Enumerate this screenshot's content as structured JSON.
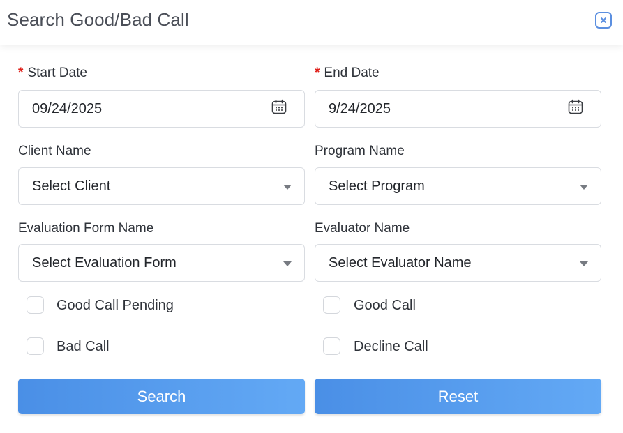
{
  "dialog": {
    "title": "Search Good/Bad Call"
  },
  "fields": {
    "start_date": {
      "label": "Start Date",
      "required_mark": "*",
      "value": "09/24/2025"
    },
    "end_date": {
      "label": "End Date",
      "required_mark": "*",
      "value": "9/24/2025"
    },
    "client_name": {
      "label": "Client Name",
      "value": "Select Client"
    },
    "program_name": {
      "label": "Program Name",
      "value": "Select Program"
    },
    "evaluation_form": {
      "label": "Evaluation Form Name",
      "value": "Select Evaluation Form"
    },
    "evaluator_name": {
      "label": "Evaluator Name",
      "value": "Select Evaluator Name"
    }
  },
  "checkboxes": {
    "good_call_pending": "Good Call Pending",
    "good_call": "Good Call",
    "bad_call": "Bad Call",
    "decline_call": "Decline Call"
  },
  "buttons": {
    "search": "Search",
    "reset": "Reset"
  },
  "colors": {
    "accent": "#5b9ff0",
    "required": "#e0201a"
  }
}
